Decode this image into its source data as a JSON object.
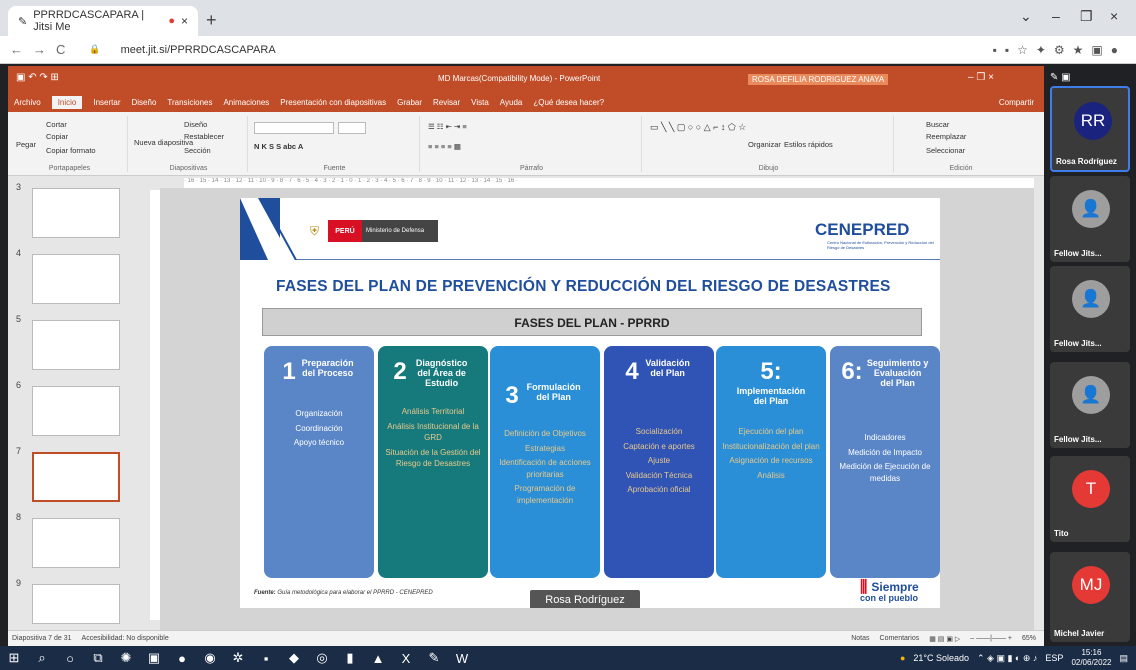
{
  "browser": {
    "tab_title": "PPRRDCASCAPARA | Jitsi Me",
    "tab_close": "×",
    "new_tab": "+",
    "url": "meet.jit.si/PPRRDCASCAPARA",
    "win_min": "–",
    "win_max": "❐",
    "win_close": "×"
  },
  "ppt": {
    "title": "MD Marcas(Compatibility Mode) - PowerPoint",
    "user": "ROSA DEFILIA RODRIGUEZ ANAYA",
    "tabs": [
      "Archivo",
      "Inicio",
      "Insertar",
      "Diseño",
      "Transiciones",
      "Animaciones",
      "Presentación con diapositivas",
      "Grabar",
      "Revisar",
      "Vista",
      "Ayuda",
      "¿Qué desea hacer?"
    ],
    "share": "Compartir",
    "ribbon": {
      "paste": "Pegar",
      "cut": "Cortar",
      "copy": "Copiar",
      "format_painter": "Copiar formato",
      "clipboard": "Portapapeles",
      "new_slide": "Nueva diapositiva",
      "layout": "Diseño",
      "reset": "Restablecer",
      "section": "Sección",
      "slides": "Diapositivas",
      "font": "Fuente",
      "paragraph": "Párrafo",
      "arrange": "Organizar",
      "quick_styles": "Estilos rápidos",
      "drawing": "Dibujo",
      "find": "Buscar",
      "replace": "Reemplazar",
      "select": "Seleccionar",
      "editing": "Edición"
    },
    "ruler": "· 16 · 15 · 14 · 13 · 12 · 11 · 10 · 9 · 8 · 7 · 6 · 5 · 4 · 3 · 2 · 1 · 0 · 1 · 2 · 3 · 4 · 5 · 6 · 7 · 8 · 9 · 10 · 11 · 12 · 13 · 14 · 15 · 16 ·",
    "thumbs": [
      "3",
      "4",
      "5",
      "6",
      "7",
      "8",
      "9"
    ],
    "status": {
      "slide": "Diapositiva 7 de 31",
      "accessibility": "Accesibilidad: No disponible",
      "notes": "Notas",
      "comments": "Comentarios",
      "zoom": "65%"
    }
  },
  "slide": {
    "peru": "PERÚ",
    "ministry": "Ministerio de Defensa",
    "cenepred": "CENEPRED",
    "cenepred_sub": "Centro Nacional de Estimación, Prevención y Reducción del Riesgo de Desastres",
    "title": "FASES DEL PLAN DE PREVENCIÓN Y REDUCCIÓN DEL RIESGO DE DESASTRES",
    "bar": "FASES DEL PLAN - PPRRD",
    "phases": [
      {
        "num": "1",
        "title": "Preparación del Proceso",
        "items": [
          "Organización",
          "Coordinación",
          "Apoyo técnico"
        ]
      },
      {
        "num": "2",
        "title": "Diagnóstico del Área de Estudio",
        "items": [
          "Análisis Territorial",
          "Análisis Institucional de la GRD",
          "Situación de la Gestión del Riesgo de Desastres"
        ]
      },
      {
        "num": "3",
        "title": "Formulación del Plan",
        "items": [
          "Definición de Objetivos",
          "Estrategias",
          "Identificación de acciones prioritarias",
          "Programación de implementación"
        ]
      },
      {
        "num": "4",
        "title": "Validación del Plan",
        "items": [
          "Socialización",
          "Captación e aportes",
          "Ajuste",
          "Validación Técnica",
          "Aprobación oficial"
        ]
      },
      {
        "num": "5:",
        "title": "Implementación del Plan",
        "items": [
          "Ejecución del plan",
          "Institucionalización del plan",
          "Asignación de recursos",
          "Análisis"
        ]
      },
      {
        "num": "6:",
        "title": "Seguimiento y Evaluación del Plan",
        "items": [
          "Indicadores",
          "Medición de Impacto",
          "Medición de Ejecución de medidas"
        ]
      }
    ],
    "fuente_label": "Fuente:",
    "fuente": "Guía metodológica para elaborar el PPRRD - CENEPRED",
    "name_tag": "Rosa Rodríguez",
    "siempre": "Siempre",
    "con_el_pueblo": "con el pueblo"
  },
  "participants": [
    {
      "initials": "RR",
      "name": "Rosa Rodríguez",
      "color": "#1a237e"
    },
    {
      "initials": "",
      "name": "Fellow Jits...",
      "color": "#9e9e9e"
    },
    {
      "initials": "",
      "name": "Fellow Jits...",
      "color": "#9e9e9e"
    },
    {
      "initials": "",
      "name": "Fellow Jits...",
      "color": "#9e9e9e"
    },
    {
      "initials": "T",
      "name": "Tito",
      "color": "#e53935"
    },
    {
      "initials": "MJ",
      "name": "Michel Javier",
      "color": "#e53935"
    }
  ],
  "taskbar": {
    "weather": "21°C Soleado",
    "lang": "ESP",
    "time": "15:16",
    "date": "02/06/2022"
  }
}
